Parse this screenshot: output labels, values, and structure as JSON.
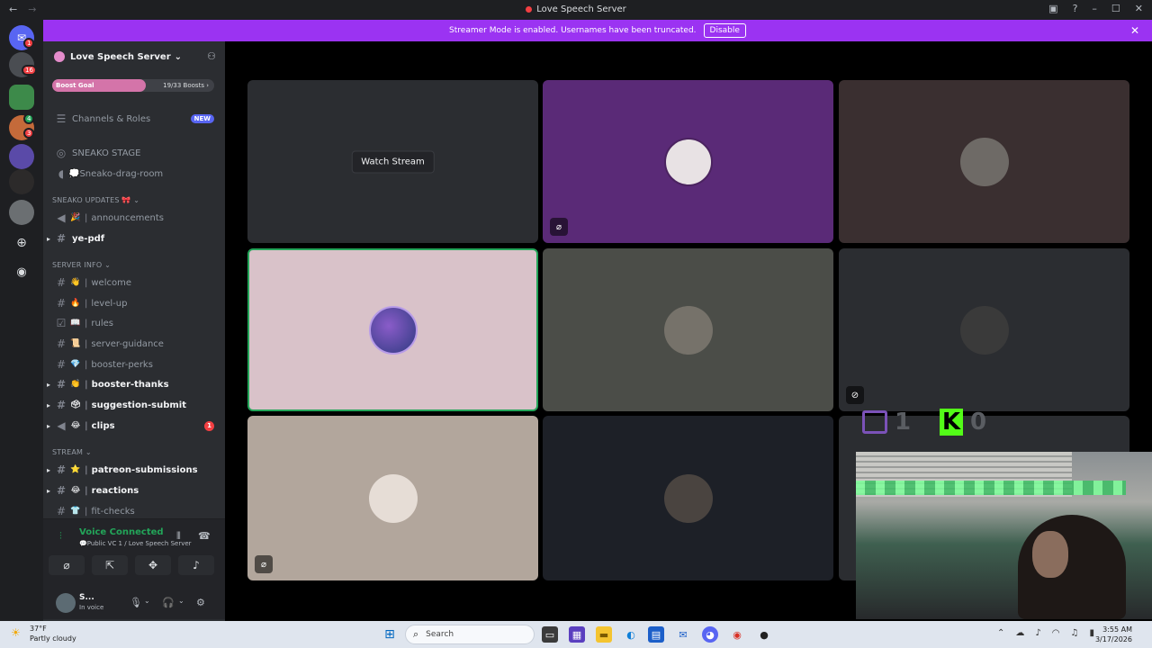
{
  "titlebar": {
    "title": "Love Speech Server",
    "back": "←",
    "forward": "→"
  },
  "banner": {
    "message": "Streamer Mode is enabled. Usernames have been truncated.",
    "action": "Disable",
    "close": "✕"
  },
  "rail": {
    "badges": [
      "1",
      "16",
      "4",
      "3"
    ]
  },
  "server": {
    "name": "Love Speech Server",
    "boost_goal_label": "Boost Goal",
    "boost_count": "19/33 Boosts",
    "boost_progress": 0.58
  },
  "channels": {
    "roles": {
      "label": "Channels & Roles",
      "badge": "NEW"
    },
    "stage_item": "SNEAKO STAGE",
    "drag_room": "💭Sneako-drag-room",
    "cat_updates": "SNEAKO UPDATES 🎀",
    "announcements": "announcements",
    "ye_pdf": "ye-pdf",
    "cat_server_info": "SERVER INFO",
    "welcome": "welcome",
    "level_up": "level-up",
    "rules": "rules",
    "server_guidance": "server-guidance",
    "booster_perks": "booster-perks",
    "booster_thanks": "booster-thanks",
    "suggestion_submit": "suggestion-submit",
    "clips": "clips",
    "clips_count": "1",
    "cat_stream": "STREAM",
    "patreon": "patreon-submissions",
    "reactions": "reactions",
    "fit_checks": "fit-checks"
  },
  "voice": {
    "status": "Voice Connected",
    "location": "💬Public VC 1 / Love Speech Server"
  },
  "user": {
    "name": "S...",
    "status": "In voice"
  },
  "stage": {
    "watch_label": "Watch Stream",
    "tiles": [
      {
        "bg": "#2b2d31"
      },
      {
        "bg": "#5a2a77",
        "muted": true
      },
      {
        "bg": "#3a2f30"
      },
      {
        "bg": "#d9c2c9",
        "speaking": true
      },
      {
        "bg": "#4b4d48"
      },
      {
        "bg": "#2b2d31",
        "stream_icon": true
      },
      {
        "bg": "#b2a69c",
        "muted": true
      },
      {
        "bg": "#1d2027"
      },
      {
        "bg": "#2b2d31"
      }
    ]
  },
  "overlay": {
    "twitch_count": "1",
    "kick_letter": "K",
    "kick_count": "0"
  },
  "taskbar": {
    "temp": "37°F",
    "weather": "Partly cloudy",
    "search_placeholder": "Search",
    "time": "3:55 AM",
    "date": "3/17/2026"
  }
}
